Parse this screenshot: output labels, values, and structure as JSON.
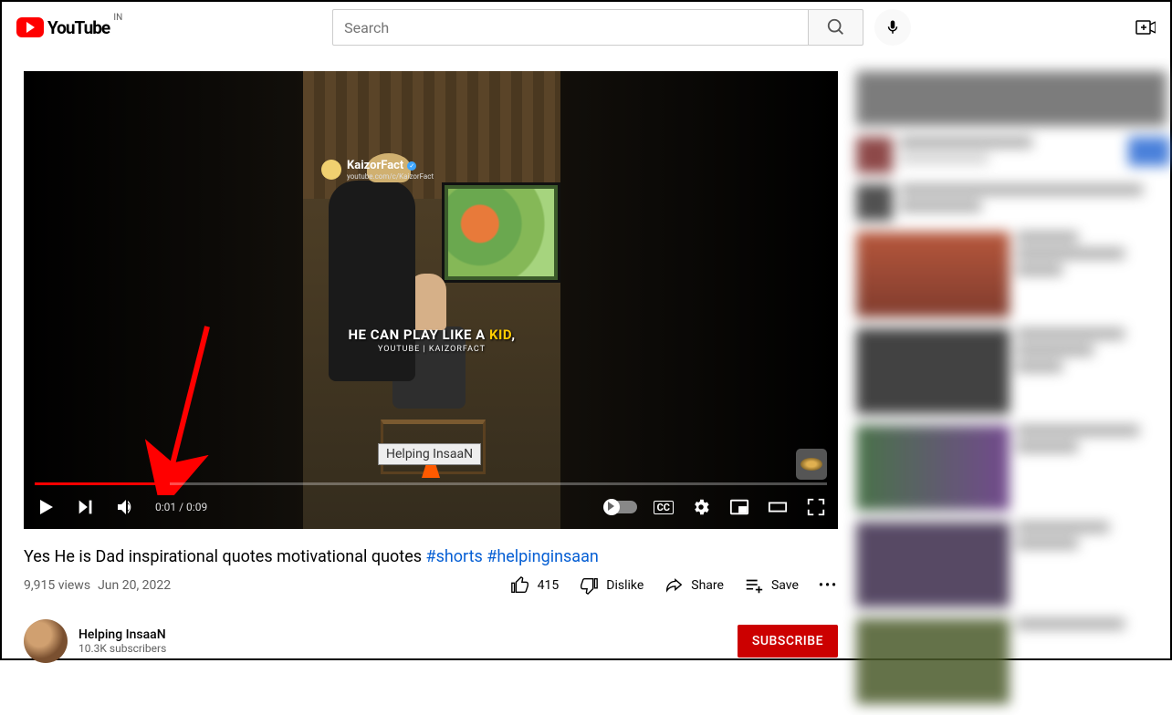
{
  "header": {
    "logo_text": "YouTube",
    "region": "IN",
    "search_placeholder": "Search"
  },
  "video": {
    "overlay": {
      "channel_name": "KaizorFact",
      "channel_sub": "youtube.com/c/KaizorFact",
      "caption_prefix": "HE CAN PLAY LIKE A ",
      "caption_highlight": "KID",
      "caption_suffix": ",",
      "caption_sub": "YOUTUBE | KAIZORFACT",
      "watermark": "Helping InsaaN"
    },
    "time_current": "0:01",
    "time_duration": "0:09",
    "progress_percent": 17
  },
  "title": {
    "text": "Yes He is Dad inspirational quotes motivational quotes ",
    "hashtag1": "#shorts",
    "hashtag2": "#helpinginsaan"
  },
  "meta": {
    "views": "9,915 views",
    "date": "Jun 20, 2022"
  },
  "actions": {
    "like_count": "415",
    "dislike_label": "Dislike",
    "share_label": "Share",
    "save_label": "Save"
  },
  "channel": {
    "name": "Helping InsaaN",
    "subs": "10.3K subscribers",
    "subscribe_label": "SUBSCRIBE"
  }
}
